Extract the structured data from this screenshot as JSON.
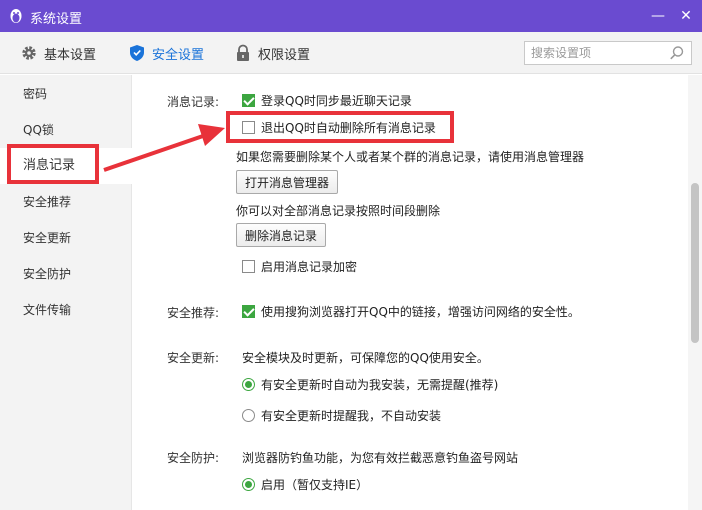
{
  "window": {
    "title": "系统设置",
    "minimize": "—",
    "close": "✕"
  },
  "toolbar": {
    "tabs": [
      {
        "label": "基本设置",
        "icon": "gear-icon"
      },
      {
        "label": "安全设置",
        "icon": "shield-icon",
        "active": true
      },
      {
        "label": "权限设置",
        "icon": "lock-icon"
      }
    ],
    "search": {
      "placeholder": "搜索设置项",
      "value": ""
    }
  },
  "sidebar": {
    "items": [
      {
        "label": "密码"
      },
      {
        "label": "QQ锁"
      },
      {
        "label": "消息记录",
        "active": true
      },
      {
        "label": "安全推荐"
      },
      {
        "label": "安全更新"
      },
      {
        "label": "安全防护"
      },
      {
        "label": "文件传输"
      }
    ]
  },
  "main": {
    "message_record": {
      "label": "消息记录:",
      "sync_login": "登录QQ时同步最近聊天记录",
      "sync_login_checked": true,
      "delete_on_exit": "退出QQ时自动删除所有消息记录",
      "delete_on_exit_checked": false,
      "manager_hint": "如果您需要删除某个人或者某个群的消息记录，请使用消息管理器",
      "open_manager_button": "打开消息管理器",
      "delete_by_time_hint": "你可以对全部消息记录按照时间段删除",
      "delete_button": "删除消息记录",
      "encrypt": "启用消息记录加密",
      "encrypt_checked": false
    },
    "security_recommend": {
      "label": "安全推荐:",
      "sogou": "使用搜狗浏览器打开QQ中的链接，增强访问网络的安全性。",
      "sogou_checked": true
    },
    "security_update": {
      "label": "安全更新:",
      "desc": "安全模块及时更新，可保障您的QQ使用安全。",
      "auto_install": "有安全更新时自动为我安装，无需提醒(推荐)",
      "remind": "有安全更新时提醒我，不自动安装",
      "selected": "auto_install"
    },
    "security_protect": {
      "label": "安全防护:",
      "desc": "浏览器防钓鱼功能，为您有效拦截恶意钓鱼盗号网站",
      "enable": "启用（暂仅支持IE）",
      "enable_selected": true
    }
  },
  "colors": {
    "titlebar": "#6a4bd0",
    "accent": "#1a73d9",
    "check": "#3ca640",
    "highlight": "#e8323a"
  }
}
